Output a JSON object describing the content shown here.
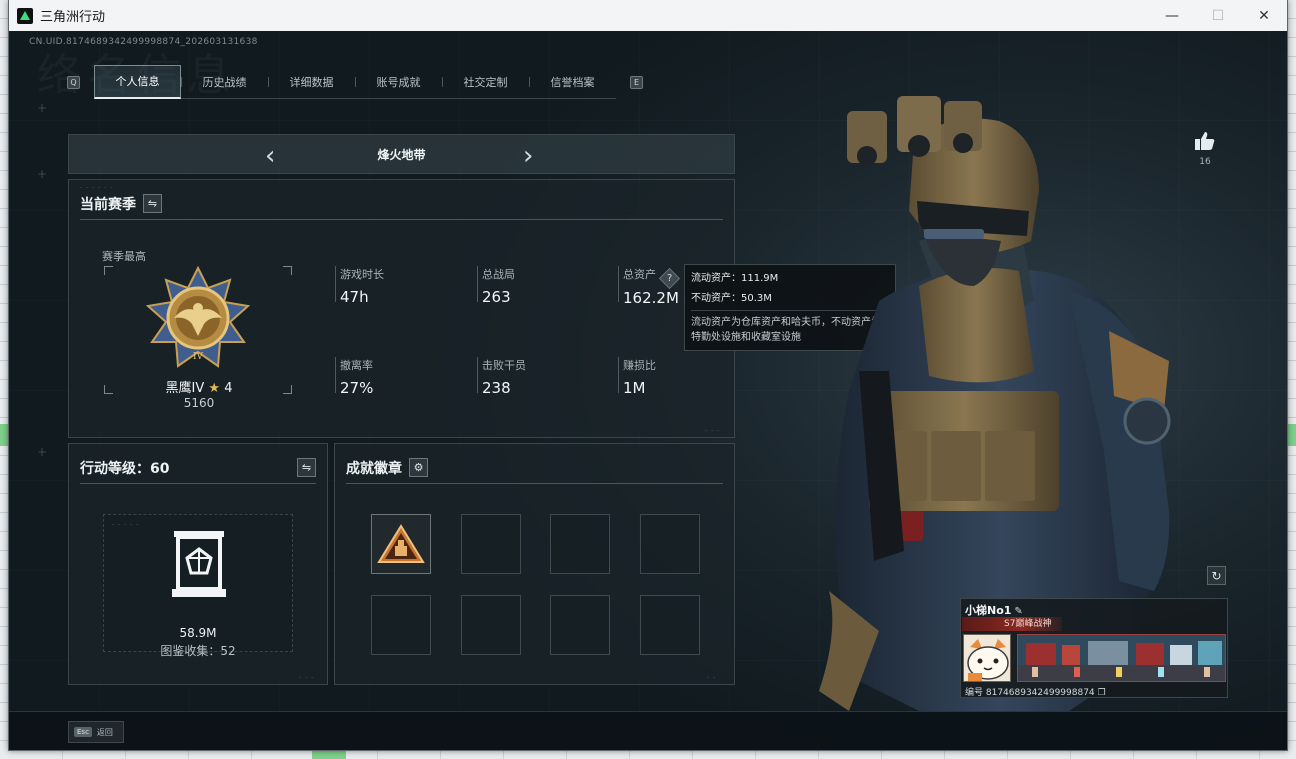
{
  "window": {
    "title": "三角洲行动",
    "minimize_symbol": "—",
    "maximize_symbol": "☐",
    "close_symbol": "✕"
  },
  "header": {
    "uid_text": "CN.UID.8174689342499998874_202603131638",
    "bg_watermark": "络名信息",
    "tab_prev_key": "Q",
    "tab_next_key": "E"
  },
  "tabs": [
    {
      "label": "个人信息",
      "active": true
    },
    {
      "label": "历史战绩",
      "active": false
    },
    {
      "label": "详细数据",
      "active": false
    },
    {
      "label": "账号成就",
      "active": false
    },
    {
      "label": "社交定制",
      "active": false
    },
    {
      "label": "信誉档案",
      "active": false
    }
  ],
  "mode_selector": {
    "prev_symbol": "‹",
    "next_symbol": "›",
    "title": "烽火地带"
  },
  "season_panel": {
    "title": "当前赛季",
    "swap_symbol": "⇋",
    "best_label": "赛季最高",
    "rank_name": "黑鹰IV",
    "rank_stars": "4",
    "rank_score": "5160",
    "stats": [
      {
        "label": "游戏时长",
        "value": "47h"
      },
      {
        "label": "总战局",
        "value": "263"
      },
      {
        "label": "总资产",
        "value": "162.2M",
        "help": "?"
      },
      {
        "label": "撤离率",
        "value": "27%"
      },
      {
        "label": "击败干员",
        "value": "238"
      },
      {
        "label": "赚损比",
        "value": "1M"
      }
    ]
  },
  "asset_tooltip": {
    "liquid": "流动资产：111.9M",
    "fixed": "不动资产：50.3M",
    "description": "流动资产为仓库资产和哈夫币，不动资产为特勤处设施和收藏室设施"
  },
  "level_panel": {
    "title": "行动等级：60",
    "swap_symbol": "⇋",
    "collection_value": "58.9M",
    "collection_label": "图鉴收集：52"
  },
  "badge_panel": {
    "title": "成就徽章",
    "settings_symbol": "⚙"
  },
  "like": {
    "count": "16"
  },
  "player_card": {
    "name": "小梯No1",
    "edit_symbol": "✎",
    "tag": "S7巅峰战神",
    "id_text": "编号 8174689342499998874",
    "copy_symbol": "❐",
    "refresh_symbol": "↻"
  },
  "bottom_bar": {
    "esc_key": "Esc",
    "esc_label": "返回"
  },
  "colors": {
    "accent": "#e8eef0",
    "panel_bg": "#1a242a",
    "rank_gold": "#c9a053",
    "rank_blue": "#3f5e8e",
    "badge_orange": "#c9742e"
  }
}
